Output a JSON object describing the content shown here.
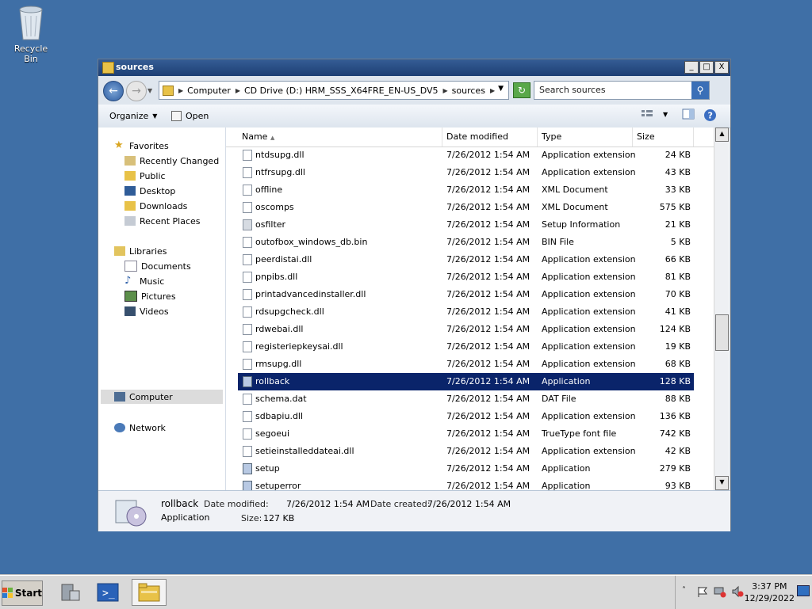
{
  "desktop": {
    "recycle_bin": "Recycle Bin"
  },
  "window": {
    "title": "sources",
    "controls": {
      "minimize": "_",
      "maximize": "□",
      "close": "X"
    }
  },
  "address": {
    "crumbs": [
      "Computer",
      "CD Drive (D:) HRM_SSS_X64FRE_EN-US_DV5",
      "sources"
    ],
    "search_placeholder": "Search sources"
  },
  "toolbar": {
    "organize": "Organize",
    "open": "Open"
  },
  "nav": {
    "favorites": "Favorites",
    "fav_items": [
      "Recently Changed",
      "Public",
      "Desktop",
      "Downloads",
      "Recent Places"
    ],
    "libraries": "Libraries",
    "lib_items": [
      "Documents",
      "Music",
      "Pictures",
      "Videos"
    ],
    "computer": "Computer",
    "network": "Network"
  },
  "columns": {
    "name": "Name",
    "date": "Date modified",
    "type": "Type",
    "size": "Size"
  },
  "files": [
    {
      "name": "ntdsupg.dll",
      "date": "7/26/2012 1:54 AM",
      "type": "Application extension",
      "size": "24 KB",
      "icon": "dll-icon"
    },
    {
      "name": "ntfrsupg.dll",
      "date": "7/26/2012 1:54 AM",
      "type": "Application extension",
      "size": "43 KB",
      "icon": "dll-icon"
    },
    {
      "name": "offline",
      "date": "7/26/2012 1:54 AM",
      "type": "XML Document",
      "size": "33 KB",
      "icon": "xml-icon"
    },
    {
      "name": "oscomps",
      "date": "7/26/2012 1:54 AM",
      "type": "XML Document",
      "size": "575 KB",
      "icon": "xml-icon"
    },
    {
      "name": "osfilter",
      "date": "7/26/2012 1:54 AM",
      "type": "Setup Information",
      "size": "21 KB",
      "icon": "inf-icon"
    },
    {
      "name": "outofbox_windows_db.bin",
      "date": "7/26/2012 1:54 AM",
      "type": "BIN File",
      "size": "5 KB",
      "icon": "file-icon"
    },
    {
      "name": "peerdistai.dll",
      "date": "7/26/2012 1:54 AM",
      "type": "Application extension",
      "size": "66 KB",
      "icon": "dll-icon"
    },
    {
      "name": "pnpibs.dll",
      "date": "7/26/2012 1:54 AM",
      "type": "Application extension",
      "size": "81 KB",
      "icon": "dll-icon"
    },
    {
      "name": "printadvancedinstaller.dll",
      "date": "7/26/2012 1:54 AM",
      "type": "Application extension",
      "size": "70 KB",
      "icon": "dll-icon"
    },
    {
      "name": "rdsupgcheck.dll",
      "date": "7/26/2012 1:54 AM",
      "type": "Application extension",
      "size": "41 KB",
      "icon": "dll-icon"
    },
    {
      "name": "rdwebai.dll",
      "date": "7/26/2012 1:54 AM",
      "type": "Application extension",
      "size": "124 KB",
      "icon": "dll-icon"
    },
    {
      "name": "registeriepkeysai.dll",
      "date": "7/26/2012 1:54 AM",
      "type": "Application extension",
      "size": "19 KB",
      "icon": "dll-icon"
    },
    {
      "name": "rmsupg.dll",
      "date": "7/26/2012 1:54 AM",
      "type": "Application extension",
      "size": "68 KB",
      "icon": "dll-icon"
    },
    {
      "name": "rollback",
      "date": "7/26/2012 1:54 AM",
      "type": "Application",
      "size": "128 KB",
      "icon": "app-icon",
      "selected": true
    },
    {
      "name": "schema.dat",
      "date": "7/26/2012 1:54 AM",
      "type": "DAT File",
      "size": "88 KB",
      "icon": "file-icon"
    },
    {
      "name": "sdbapiu.dll",
      "date": "7/26/2012 1:54 AM",
      "type": "Application extension",
      "size": "136 KB",
      "icon": "dll-icon"
    },
    {
      "name": "segoeui",
      "date": "7/26/2012 1:54 AM",
      "type": "TrueType font file",
      "size": "742 KB",
      "icon": "font-icon"
    },
    {
      "name": "setieinstalleddateai.dll",
      "date": "7/26/2012 1:54 AM",
      "type": "Application extension",
      "size": "42 KB",
      "icon": "dll-icon"
    },
    {
      "name": "setup",
      "date": "7/26/2012 1:54 AM",
      "type": "Application",
      "size": "279 KB",
      "icon": "setup-icon"
    },
    {
      "name": "setuperror",
      "date": "7/26/2012 1:54 AM",
      "type": "Application",
      "size": "93 KB",
      "icon": "setup-icon"
    }
  ],
  "details": {
    "name": "rollback",
    "type": "Application",
    "modified_label": "Date modified:",
    "modified": "7/26/2012 1:54 AM",
    "created_label": "Date created:",
    "created": "7/26/2012 1:54 AM",
    "size_label": "Size:",
    "size": "127 KB"
  },
  "taskbar": {
    "start": "Start",
    "time": "3:37 PM",
    "date": "12/29/2022"
  },
  "colors": {
    "desktop": "#3f6fa6",
    "selection": "#0a246a",
    "title": "#1d3f74"
  }
}
